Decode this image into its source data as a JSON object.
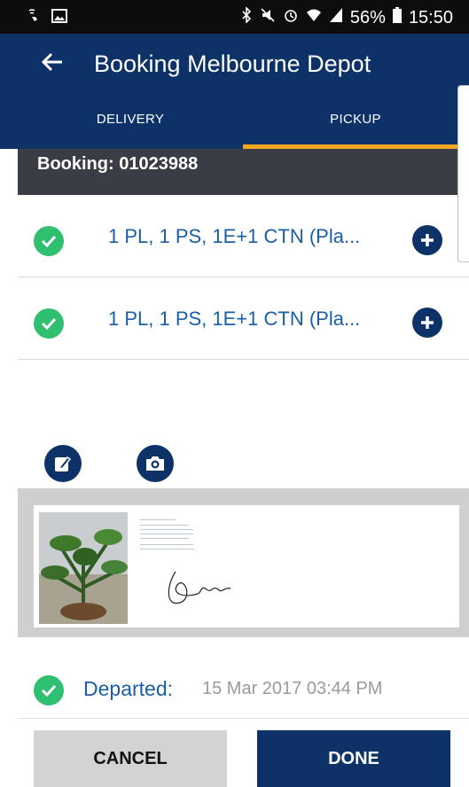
{
  "status_bar": {
    "left_icons": [
      "wifi-calling-icon",
      "image-icon"
    ],
    "right_icons": [
      "bluetooth-icon",
      "mute-icon",
      "alarm-icon",
      "wifi-icon",
      "signal-icon",
      "battery-icon"
    ],
    "battery": "56%",
    "time": "15:50"
  },
  "appbar": {
    "title": "Booking Melbourne Depot"
  },
  "tabs": [
    {
      "label": "DELIVERY",
      "active": false
    },
    {
      "label": "PICKUP",
      "active": true
    }
  ],
  "booking": {
    "label": "Booking: 01023988"
  },
  "items": [
    {
      "label": "1 PL,  1 PS,  1E+1 CTN (Pla..."
    },
    {
      "label": "1 PL,  1 PS,  1E+1 CTN (Pla..."
    }
  ],
  "departed": {
    "label": "Departed:",
    "value": "15 Mar 2017 03:44 PM"
  },
  "buttons": {
    "cancel": "CANCEL",
    "done": "DONE"
  },
  "colors": {
    "primary": "#0c3268",
    "accent": "#f5a623",
    "success": "#2fbf71",
    "link": "#1a5ea8",
    "booking_bar": "#3a3e44"
  }
}
